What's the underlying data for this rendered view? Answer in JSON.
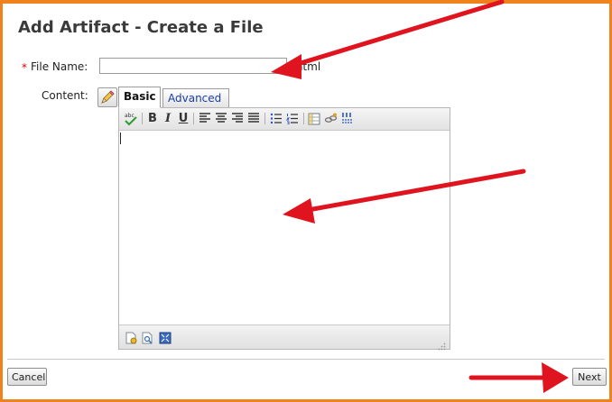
{
  "page": {
    "title": "Add Artifact - Create a File"
  },
  "form": {
    "required_marker": "*",
    "file_name_label": "File Name:",
    "file_name_value": "",
    "file_extension": ".html",
    "content_label": "Content:"
  },
  "editor": {
    "tabs": [
      {
        "label": "Basic",
        "active": true
      },
      {
        "label": "Advanced",
        "active": false
      }
    ],
    "toolbar_icons": [
      "spellcheck-icon",
      "bold-icon",
      "italic-icon",
      "underline-icon",
      "align-left-icon",
      "align-center-icon",
      "align-right-icon",
      "align-justify-icon",
      "bulleted-list-icon",
      "numbered-list-icon",
      "table-icon",
      "link-icon",
      "more-icon"
    ],
    "toolbar_text": {
      "bold": "B",
      "italic": "I",
      "underline": "U",
      "spell": "abc"
    }
  },
  "buttons": {
    "cancel": "Cancel",
    "next": "Next"
  },
  "colors": {
    "frame_border": "#f0821e",
    "arrow": "#e0141e",
    "link": "#1a3fa8",
    "required": "#dd0000"
  }
}
